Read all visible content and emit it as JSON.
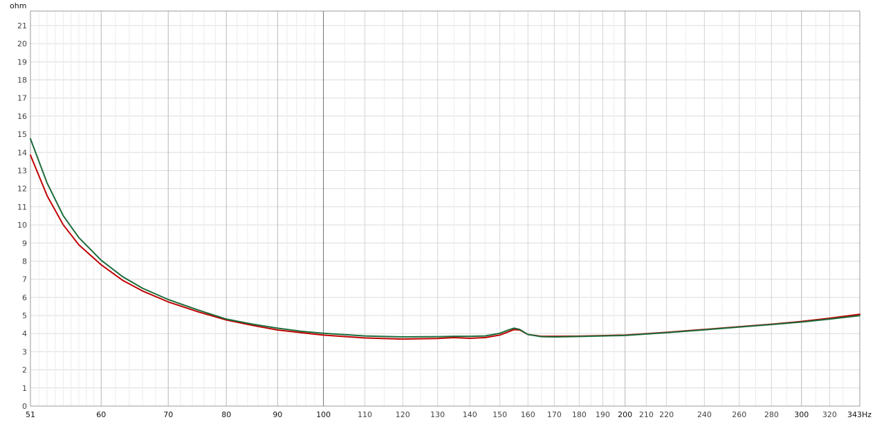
{
  "chart_data": {
    "type": "line",
    "title": "",
    "xlabel": "Hz",
    "ylabel": "ohm",
    "x_scale": "log",
    "xlim": [
      51,
      343
    ],
    "ylim": [
      0,
      21.8
    ],
    "grid": true,
    "x_ticks": [
      {
        "value": 51,
        "label": "51",
        "major": true
      },
      {
        "value": 60,
        "label": "60",
        "major": true
      },
      {
        "value": 70,
        "label": "70",
        "major": true
      },
      {
        "value": 80,
        "label": "80",
        "major": true
      },
      {
        "value": 90,
        "label": "90",
        "major": true
      },
      {
        "value": 100,
        "label": "100",
        "major": true
      },
      {
        "value": 110,
        "label": "110",
        "major": false
      },
      {
        "value": 120,
        "label": "120",
        "major": false
      },
      {
        "value": 130,
        "label": "130",
        "major": false
      },
      {
        "value": 140,
        "label": "140",
        "major": false
      },
      {
        "value": 150,
        "label": "150",
        "major": false
      },
      {
        "value": 160,
        "label": "160",
        "major": false
      },
      {
        "value": 170,
        "label": "170",
        "major": false
      },
      {
        "value": 180,
        "label": "180",
        "major": false
      },
      {
        "value": 190,
        "label": "190",
        "major": false
      },
      {
        "value": 200,
        "label": "200",
        "major": true
      },
      {
        "value": 210,
        "label": "210",
        "major": false
      },
      {
        "value": 220,
        "label": "220",
        "major": false
      },
      {
        "value": 240,
        "label": "240",
        "major": false
      },
      {
        "value": 260,
        "label": "260",
        "major": false
      },
      {
        "value": 280,
        "label": "280",
        "major": false
      },
      {
        "value": 300,
        "label": "300",
        "major": true
      },
      {
        "value": 320,
        "label": "320",
        "major": false
      },
      {
        "value": 343,
        "label": "343Hz",
        "major": true
      }
    ],
    "y_ticks": [
      0,
      1,
      2,
      3,
      4,
      5,
      6,
      7,
      8,
      9,
      10,
      11,
      12,
      13,
      14,
      15,
      16,
      17,
      18,
      19,
      20,
      21
    ],
    "series": [
      {
        "color": "#c00000",
        "x": [
          51,
          53,
          55,
          57,
          60,
          63,
          66,
          70,
          75,
          80,
          85,
          90,
          95,
          100,
          110,
          120,
          130,
          135,
          140,
          145,
          150,
          153,
          155,
          157,
          160,
          165,
          170,
          180,
          190,
          200,
          220,
          240,
          260,
          280,
          300,
          320,
          343
        ],
        "y": [
          13.85,
          11.6,
          10.0,
          8.9,
          7.8,
          6.95,
          6.35,
          5.75,
          5.2,
          4.75,
          4.45,
          4.2,
          4.05,
          3.92,
          3.76,
          3.7,
          3.73,
          3.78,
          3.74,
          3.78,
          3.92,
          4.1,
          4.22,
          4.2,
          3.95,
          3.85,
          3.85,
          3.86,
          3.89,
          3.92,
          4.07,
          4.23,
          4.38,
          4.52,
          4.67,
          4.85,
          5.07
        ]
      },
      {
        "color": "#1a6b3a",
        "x": [
          51,
          53,
          55,
          57,
          60,
          63,
          66,
          70,
          75,
          80,
          85,
          90,
          95,
          100,
          110,
          120,
          130,
          135,
          140,
          145,
          150,
          153,
          155,
          157,
          160,
          165,
          170,
          180,
          190,
          200,
          220,
          240,
          260,
          280,
          300,
          320,
          343
        ],
        "y": [
          14.75,
          12.3,
          10.5,
          9.3,
          8.05,
          7.15,
          6.5,
          5.88,
          5.3,
          4.8,
          4.52,
          4.3,
          4.13,
          4.02,
          3.87,
          3.82,
          3.83,
          3.85,
          3.85,
          3.87,
          4.02,
          4.2,
          4.3,
          4.23,
          3.95,
          3.83,
          3.82,
          3.84,
          3.87,
          3.9,
          4.05,
          4.21,
          4.36,
          4.5,
          4.64,
          4.8,
          4.99
        ]
      }
    ]
  }
}
